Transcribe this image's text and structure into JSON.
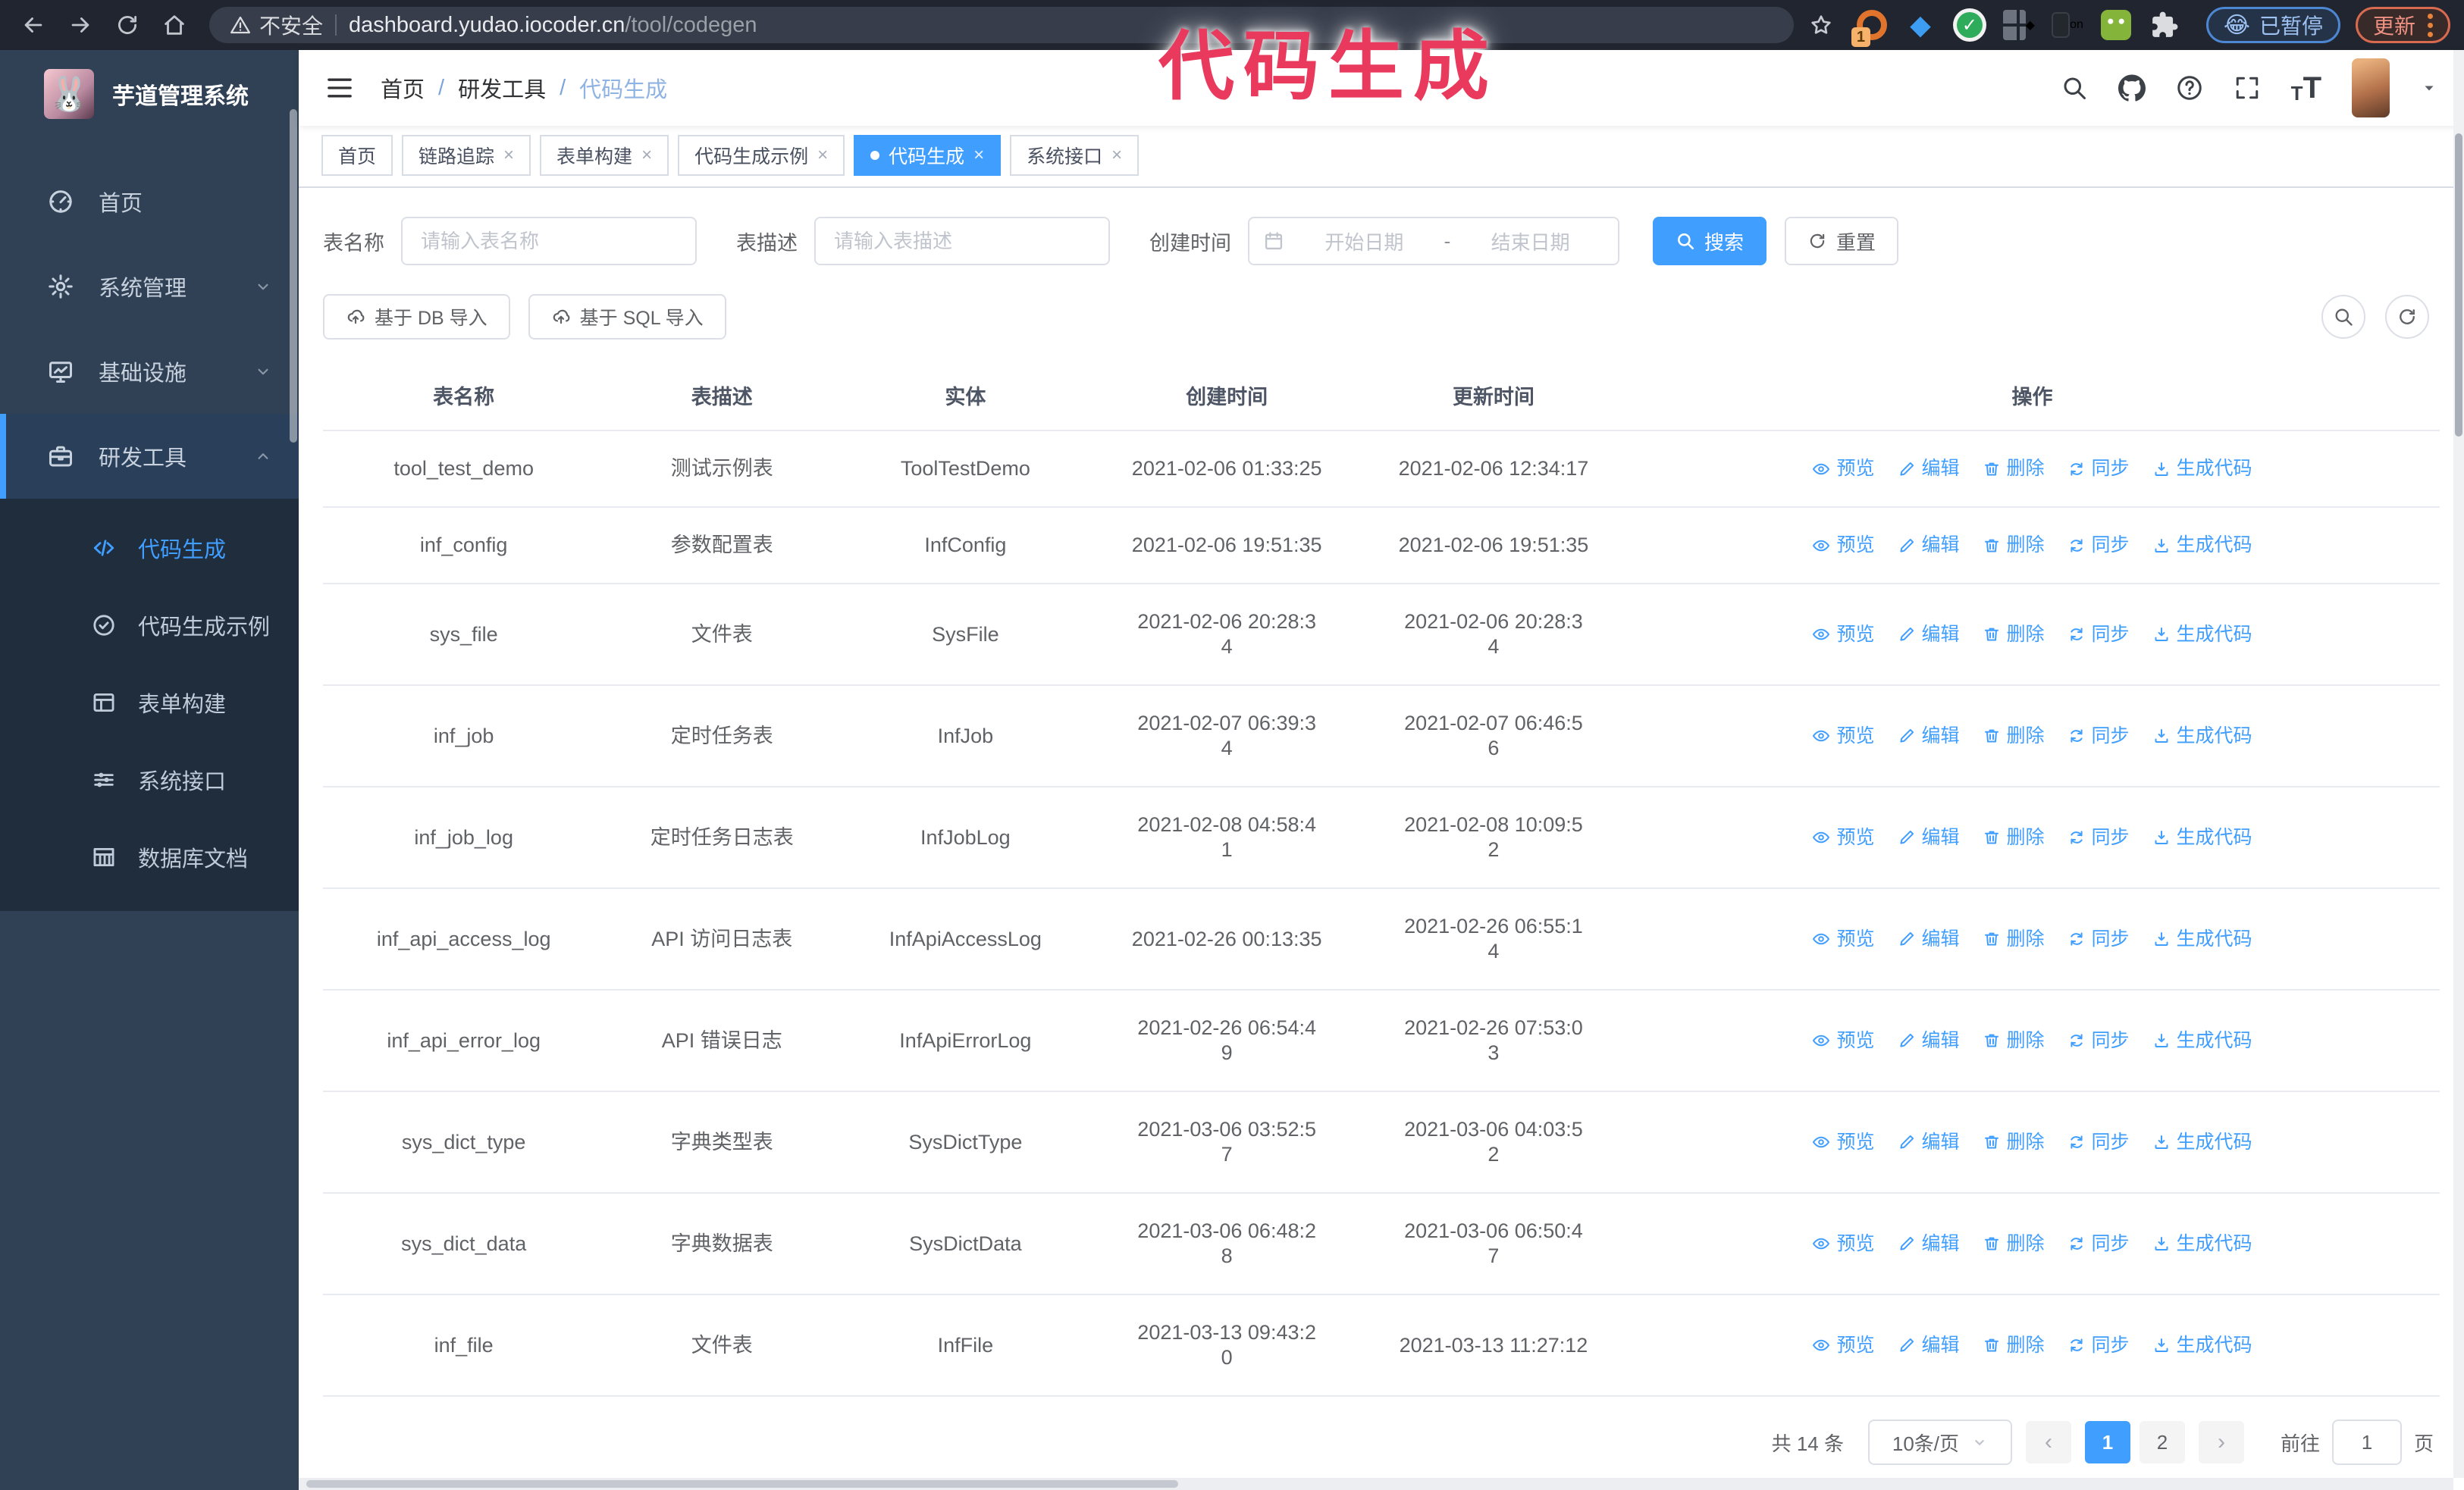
{
  "browser": {
    "secure_label": "不安全",
    "url_host": "dashboard.yudao.iocoder.cn",
    "url_path": "/tool/codegen",
    "ext_orange_badge": "1",
    "ext_on_badge": "on",
    "ext_check_glyph": "✓",
    "paused_label": "已暂停",
    "paused_emoji": "😂",
    "update_label": "更新"
  },
  "annotation": {
    "text": "代码生成",
    "color": "#e9395c"
  },
  "sidebar": {
    "title": "芋道管理系统",
    "logo_glyph": "🐰",
    "menu": [
      {
        "key": "home",
        "label": "首页",
        "icon": "dashboard-icon"
      },
      {
        "key": "system",
        "label": "系统管理",
        "icon": "gear-icon",
        "chevron": "down"
      },
      {
        "key": "infra",
        "label": "基础设施",
        "icon": "monitor-icon",
        "chevron": "down"
      },
      {
        "key": "devtools",
        "label": "研发工具",
        "icon": "toolbox-icon",
        "chevron": "up",
        "active": true,
        "children": [
          {
            "key": "codegen",
            "label": "代码生成",
            "icon": "code-icon",
            "active": true
          },
          {
            "key": "codegen-example",
            "label": "代码生成示例",
            "icon": "badge-check-icon"
          },
          {
            "key": "form-builder",
            "label": "表单构建",
            "icon": "form-icon"
          },
          {
            "key": "system-api",
            "label": "系统接口",
            "icon": "sliders-icon"
          },
          {
            "key": "db-doc",
            "label": "数据库文档",
            "icon": "table-grid-icon"
          }
        ]
      }
    ]
  },
  "header": {
    "breadcrumb": [
      "首页",
      "研发工具",
      "代码生成"
    ],
    "separator": "/"
  },
  "tabs": [
    {
      "label": "首页",
      "closable": false
    },
    {
      "label": "链路追踪",
      "closable": true
    },
    {
      "label": "表单构建",
      "closable": true
    },
    {
      "label": "代码生成示例",
      "closable": true
    },
    {
      "label": "代码生成",
      "closable": true,
      "active": true
    },
    {
      "label": "系统接口",
      "closable": true
    }
  ],
  "search": {
    "name_label": "表名称",
    "name_placeholder": "请输入表名称",
    "desc_label": "表描述",
    "desc_placeholder": "请输入表描述",
    "time_label": "创建时间",
    "start_placeholder": "开始日期",
    "range_separator": "-",
    "end_placeholder": "结束日期",
    "search_label": "搜索",
    "reset_label": "重置"
  },
  "toolbar": {
    "db_import_label": "基于 DB 导入",
    "sql_import_label": "基于 SQL 导入"
  },
  "table": {
    "columns": [
      "表名称",
      "表描述",
      "实体",
      "创建时间",
      "更新时间",
      "操作"
    ],
    "ops": [
      {
        "key": "preview",
        "label": "预览",
        "icon": "eye-icon"
      },
      {
        "key": "edit",
        "label": "编辑",
        "icon": "edit-icon"
      },
      {
        "key": "delete",
        "label": "删除",
        "icon": "trash-icon"
      },
      {
        "key": "sync",
        "label": "同步",
        "icon": "sync-icon"
      },
      {
        "key": "generate",
        "label": "生成代码",
        "icon": "download-icon"
      }
    ],
    "rows": [
      {
        "name": "tool_test_demo",
        "desc": "测试示例表",
        "entity": "ToolTestDemo",
        "created": "2021-02-06 01:33:25",
        "updated": "2021-02-06 12:34:17"
      },
      {
        "name": "inf_config",
        "desc": "参数配置表",
        "entity": "InfConfig",
        "created": "2021-02-06 19:51:35",
        "updated": "2021-02-06 19:51:35"
      },
      {
        "name": "sys_file",
        "desc": "文件表",
        "entity": "SysFile",
        "created": "2021-02-06 20:28:3\n4",
        "updated": "2021-02-06 20:28:3\n4"
      },
      {
        "name": "inf_job",
        "desc": "定时任务表",
        "entity": "InfJob",
        "created": "2021-02-07 06:39:3\n4",
        "updated": "2021-02-07 06:46:5\n6"
      },
      {
        "name": "inf_job_log",
        "desc": "定时任务日志表",
        "entity": "InfJobLog",
        "created": "2021-02-08 04:58:4\n1",
        "updated": "2021-02-08 10:09:5\n2"
      },
      {
        "name": "inf_api_access_log",
        "desc": "API 访问日志表",
        "entity": "InfApiAccessLog",
        "created": "2021-02-26 00:13:35",
        "updated": "2021-02-26 06:55:1\n4"
      },
      {
        "name": "inf_api_error_log",
        "desc": "API 错误日志",
        "entity": "InfApiErrorLog",
        "created": "2021-02-26 06:54:4\n9",
        "updated": "2021-02-26 07:53:0\n3"
      },
      {
        "name": "sys_dict_type",
        "desc": "字典类型表",
        "entity": "SysDictType",
        "created": "2021-03-06 03:52:5\n7",
        "updated": "2021-03-06 04:03:5\n2"
      },
      {
        "name": "sys_dict_data",
        "desc": "字典数据表",
        "entity": "SysDictData",
        "created": "2021-03-06 06:48:2\n8",
        "updated": "2021-03-06 06:50:4\n7"
      },
      {
        "name": "inf_file",
        "desc": "文件表",
        "entity": "InfFile",
        "created": "2021-03-13 09:43:2\n0",
        "updated": "2021-03-13 11:27:12"
      }
    ]
  },
  "pagination": {
    "total": "共 14 条",
    "page_size": "10条/页",
    "pages": [
      "1",
      "2"
    ],
    "active_page": "1",
    "prev": "‹",
    "next": "›",
    "goto_label": "前往",
    "goto_value": "1",
    "page_label": "页"
  },
  "colors": {
    "accent": "#409eff",
    "sidebar_bg": "#304156",
    "submenu_bg": "#1f2d3d",
    "annotation": "#e9395c"
  }
}
